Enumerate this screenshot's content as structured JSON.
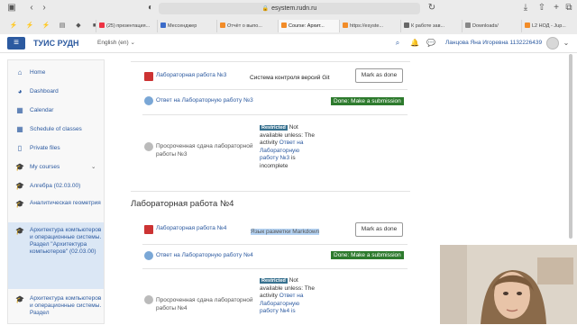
{
  "browser": {
    "url": "esystem.rudn.ru",
    "tabs": [
      {
        "label": "(25) презентация...",
        "color": "#e34",
        "active": false
      },
      {
        "label": "Мессенджер",
        "color": "#3b6bc9",
        "active": false
      },
      {
        "label": "Отчёт о выпо...",
        "color": "#f28c28",
        "active": false
      },
      {
        "label": "Course: Архит...",
        "color": "#f28c28",
        "active": true
      },
      {
        "label": "https://esyste...",
        "color": "#f28c28",
        "active": false
      },
      {
        "label": "К работе зав...",
        "color": "#666",
        "active": false
      },
      {
        "label": "Downloads/",
        "color": "#888",
        "active": false
      },
      {
        "label": "L2 НОД - Jup...",
        "color": "#f28c28",
        "active": false
      }
    ]
  },
  "navbar": {
    "logo": "ТУИС РУДН",
    "language": "English (en)",
    "user_name": "Ланцова Яна Игоревна 1132226439"
  },
  "sidebar": {
    "items": [
      {
        "label": "Home",
        "icon": "home-icon"
      },
      {
        "label": "Dashboard",
        "icon": "dashboard-icon"
      },
      {
        "label": "Calendar",
        "icon": "calendar-icon"
      },
      {
        "label": "Schedule of classes",
        "icon": "calendar-icon"
      },
      {
        "label": "Private files",
        "icon": "file-icon"
      },
      {
        "label": "My courses",
        "icon": "graduation-cap-icon"
      }
    ],
    "courses": [
      "Алгебра (02.03.00)",
      "Аналитическая геометрия",
      "Архитектура компьютеров и операционные системы. Раздел \"Архитектура компьютеров\" (02.03.00)",
      "Архитектура компьютеров и операционные системы. Раздел"
    ]
  },
  "lab3": {
    "assignment_link": "Лабораторная работа №3",
    "assignment_desc": "Система контроля версий Git",
    "mark_button": "Mark as done",
    "answer_link": "Ответ на Лабораторную работу №3",
    "done_badge": "Done: Make a submission",
    "late_label": "Просроченная сдача лабораторной работы №3",
    "restricted_badge": "Restricted",
    "restricted_text": "Not available unless: The activity",
    "restricted_link": "Ответ на Лабораторную работу №3",
    "restricted_tail": "is incomplete"
  },
  "lab4": {
    "section_title": "Лабораторная работа №4",
    "assignment_link": "Лабораторная работа №4",
    "assignment_desc": "Язык разметки Markdown",
    "mark_button": "Mark as done",
    "answer_link": "Ответ на Лабораторную работу №4",
    "done_badge": "Done: Make a submission",
    "late_label": "Просроченная сдача лабораторной работы №4",
    "restricted_badge": "Restricted",
    "restricted_text": "Not available unless: The activity",
    "restricted_link": "Ответ на Лабораторную работу №4 is"
  }
}
